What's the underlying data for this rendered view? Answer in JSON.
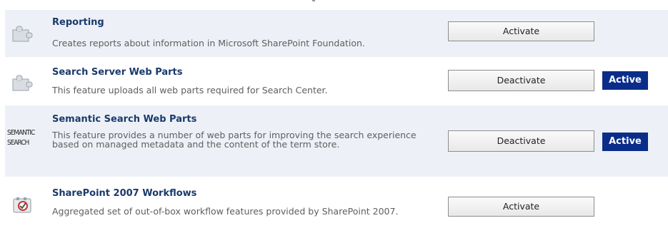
{
  "features": [
    {
      "title": "Reporting",
      "description": "Creates reports about information in Microsoft SharePoint Foundation.",
      "button_label": "Activate",
      "icon": "puzzle-icon"
    },
    {
      "title": "Search Server Web Parts",
      "description": "This feature uploads all web parts required for Search Center.",
      "button_label": "Deactivate",
      "status": "Active",
      "icon": "puzzle-icon"
    },
    {
      "title": "Semantic Search Web Parts",
      "description": "This feature provides a number of web parts for improving the search experience based on managed metadata and the content of the term store.",
      "button_label": "Deactivate",
      "status": "Active",
      "icon": "semantic-search-logo",
      "logo_line_1": "SEMANTIC",
      "logo_line_2": "SEARCH"
    },
    {
      "title": "SharePoint 2007 Workflows",
      "description": "Aggregated set of out-of-box workflow features provided by SharePoint 2007.",
      "button_label": "Activate",
      "icon": "workflow-icon"
    }
  ],
  "colors": {
    "shaded_row": "#edf1f7",
    "title": "#1a3a6b",
    "badge": "#0a2d8a"
  }
}
